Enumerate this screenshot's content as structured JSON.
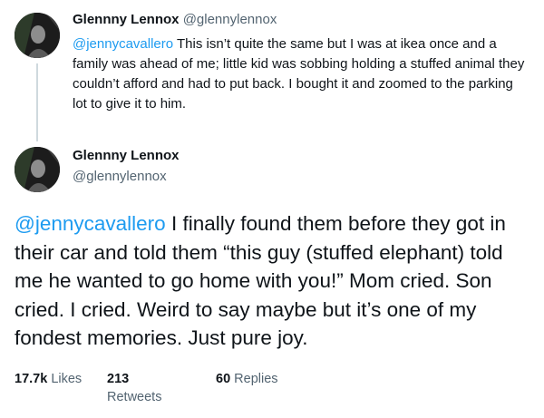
{
  "reply": {
    "author_name": "Glennny Lennox",
    "author_handle": "@glennylennox",
    "mention": "@jennycavallero",
    "text": " This isn’t quite the same but I was at ikea once and a family was ahead of me; little kid was sobbing holding a stuffed animal they couldn’t afford and had to put back. I bought it and zoomed to the parking lot to give it to him.",
    "avatar_icon": "profile-photo"
  },
  "main": {
    "author_name": "Glennny Lennox",
    "author_handle": "@glennylennox",
    "mention": "@jennycavallero",
    "text": " I finally found them before they got in their car and told them “this guy (stuffed elephant) told me he wanted to go home with you!” Mom cried. Son cried. I cried. Weird to say maybe but it’s one of my fondest memories. Just pure joy.",
    "avatar_icon": "profile-photo"
  },
  "stats": {
    "likes_count": "17.7k",
    "likes_label": "Likes",
    "retweets_count": "213",
    "retweets_label": "Retweets",
    "replies_count": "60",
    "replies_label": "Replies"
  },
  "colors": {
    "mention": "#1d9bf0",
    "secondary_text": "#536471",
    "primary_text": "#0f1419",
    "thread_line": "#cfd9de"
  }
}
